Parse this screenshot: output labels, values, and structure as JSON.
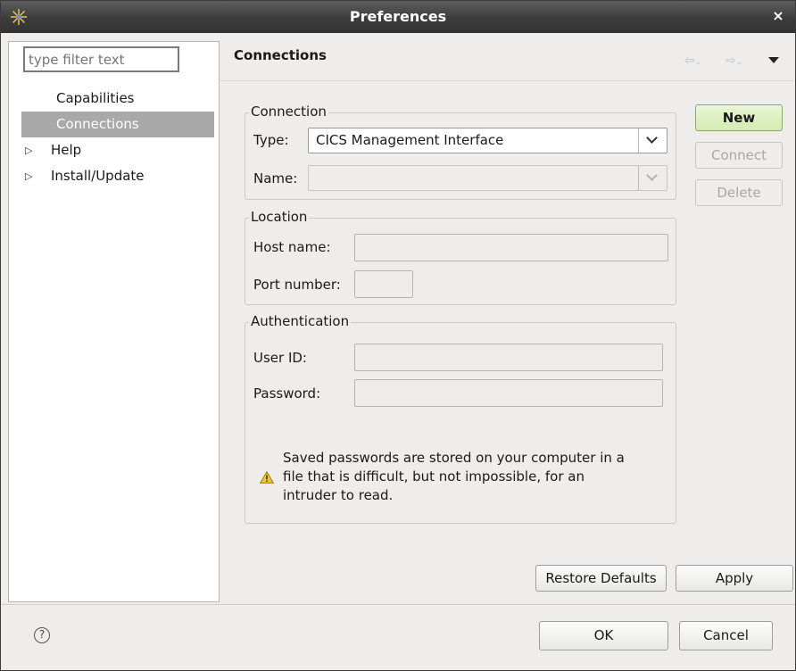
{
  "window": {
    "title": "Preferences",
    "close_glyph": "×"
  },
  "sidebar": {
    "filter_placeholder": "type filter text",
    "items": [
      {
        "label": "Capabilities"
      },
      {
        "label": "Connections"
      },
      {
        "label": "Help"
      },
      {
        "label": "Install/Update"
      }
    ]
  },
  "page": {
    "title": "Connections",
    "connection_group": {
      "legend": "Connection",
      "type_label": "Type:",
      "type_value": "CICS Management Interface",
      "name_label": "Name:",
      "name_value": ""
    },
    "location_group": {
      "legend": "Location",
      "host_label": "Host name:",
      "host_value": "",
      "port_label": "Port number:",
      "port_value": ""
    },
    "auth_group": {
      "legend": "Authentication",
      "user_label": "User ID:",
      "user_value": "",
      "password_label": "Password:",
      "password_value": "",
      "warning": "Saved passwords are stored on your computer in a file that is difficult, but not impossible, for an intruder to read."
    },
    "buttons": {
      "new": "New",
      "connect": "Connect",
      "delete": "Delete"
    },
    "restore_defaults": "Restore Defaults",
    "apply": "Apply"
  },
  "footer": {
    "ok": "OK",
    "cancel": "Cancel",
    "help_glyph": "?"
  },
  "icons": {
    "app": "eclipse-star-icon",
    "back": "back-arrow-icon",
    "forward": "forward-arrow-icon",
    "view_menu": "view-menu-icon",
    "warning": "warning-icon",
    "help": "help-icon"
  },
  "colors": {
    "title_bar": "#3c3c3c",
    "selection": "#a9a9a9",
    "new_button": "#d3ecb2"
  }
}
